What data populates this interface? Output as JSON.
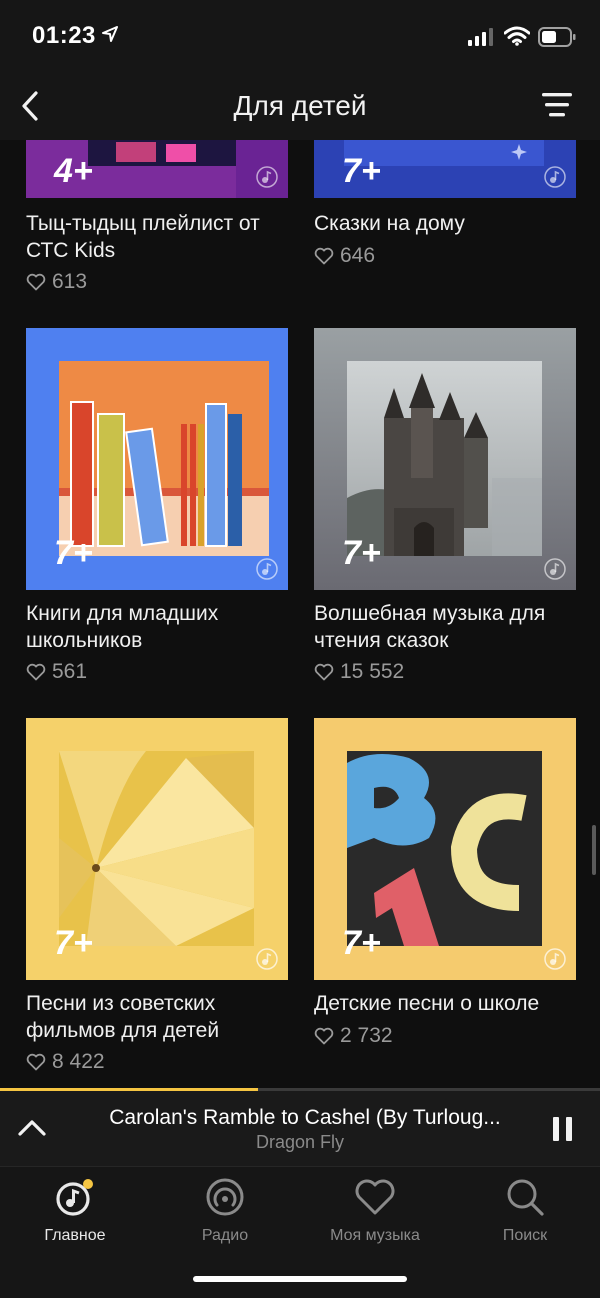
{
  "status_bar": {
    "time": "01:23"
  },
  "nav": {
    "title": "Для детей"
  },
  "playlists": [
    {
      "title": "Тыц-тыдыц плейлист от СТС Kids",
      "likes": "613",
      "age": "4+"
    },
    {
      "title": "Сказки на дому",
      "likes": "646",
      "age": "7+"
    },
    {
      "title": "Книги для младших школьников",
      "likes": "561",
      "age": "7+"
    },
    {
      "title": "Волшебная музыка для чтения сказок",
      "likes": "15 552",
      "age": "7+"
    },
    {
      "title": "Песни из советских фильмов для детей",
      "likes": "8 422",
      "age": "7+"
    },
    {
      "title": "Детские песни о школе",
      "likes": "2 732",
      "age": "7+"
    }
  ],
  "player": {
    "track_title": "Carolan's Ramble to Cashel (By Turloug...",
    "artist": "Dragon Fly",
    "progress": 0.43
  },
  "tabs": [
    {
      "label": "Главное",
      "icon": "home-note-icon",
      "active": true
    },
    {
      "label": "Радио",
      "icon": "radio-icon",
      "active": false
    },
    {
      "label": "Моя музыка",
      "icon": "heart-icon",
      "active": false
    },
    {
      "label": "Поиск",
      "icon": "search-icon",
      "active": false
    }
  ],
  "colors": {
    "accent": "#f5c542",
    "background": "#0f0f0f"
  }
}
